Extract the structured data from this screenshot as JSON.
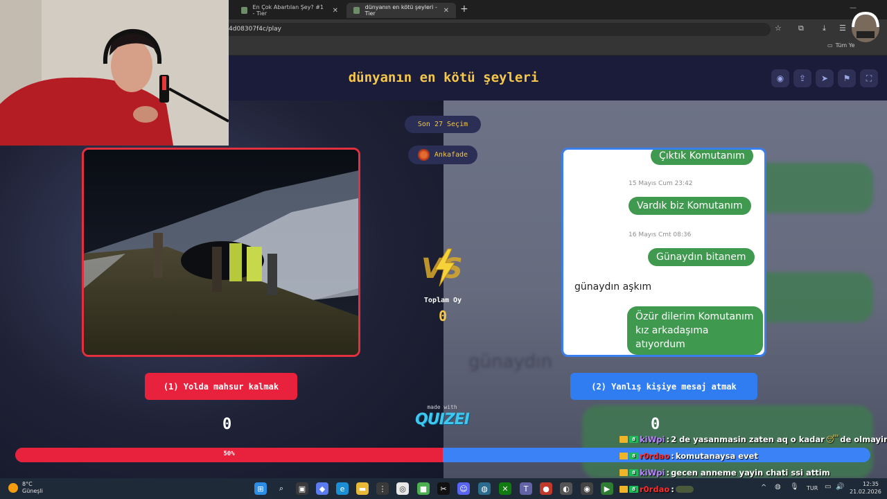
{
  "browser": {
    "tabs": [
      {
        "title": "En Çok Abartılan Şey? #1 - Tier",
        "active": false
      },
      {
        "title": "dünyanın en kötü şeyleri - Tier",
        "active": true
      }
    ],
    "url": "4d08307f4c/play",
    "bookmarks_folder": "Tüm Ye"
  },
  "quiz": {
    "title": "dünyanın en kötü şeyleri",
    "last_choice_pill": "Son 27 Seçim",
    "author": "Ankafade",
    "total_label": "Toplam Oy",
    "total_votes": "0",
    "made_with": "made with",
    "brand": "QUIZEI",
    "left": {
      "label": "(1) Yolda mahsur kalmak",
      "score": "0",
      "color": "#e8213d"
    },
    "right": {
      "label": "(2) Yanlış kişiye mesaj atmak",
      "score": "0",
      "color": "#2f7df0"
    },
    "progress": {
      "left_percent": 50,
      "label": "50%"
    }
  },
  "chat_screenshot": {
    "messages": [
      {
        "type": "out",
        "text": "Çıktık Komutanım"
      },
      {
        "type": "time",
        "text": "15 Mayıs Cum 23:42"
      },
      {
        "type": "out",
        "text": "Vardık biz Komutanım"
      },
      {
        "type": "time",
        "text": "16 Mayıs Cmt 08:36"
      },
      {
        "type": "out",
        "text": "Günaydın bitanem"
      },
      {
        "type": "in",
        "text": "günaydın aşkım"
      },
      {
        "type": "out",
        "text": "Özür dilerim Komutanım kız arkadaşıma atıyordum"
      }
    ]
  },
  "stream_chat": [
    {
      "user": "kiWpi",
      "user_color": "#b784ff",
      "message": "2 de yasanmasin zaten aq o kadar",
      "suffix": "de olmayin"
    },
    {
      "user": "r0rdao",
      "user_color": "#ff2b2b",
      "message": "komutanaysa evet",
      "suffix": ""
    },
    {
      "user": "kiWpi",
      "user_color": "#b784ff",
      "message": "gecen anneme yayin chati ssi attim",
      "suffix": ""
    },
    {
      "user": "r0rdao",
      "user_color": "#ff2b2b",
      "message": "",
      "suffix": ""
    }
  ],
  "taskbar": {
    "weather_temp": "8°C",
    "weather_desc": "Güneşli",
    "lang": "TUR",
    "time": "12:35",
    "date": "21.02.2026"
  }
}
